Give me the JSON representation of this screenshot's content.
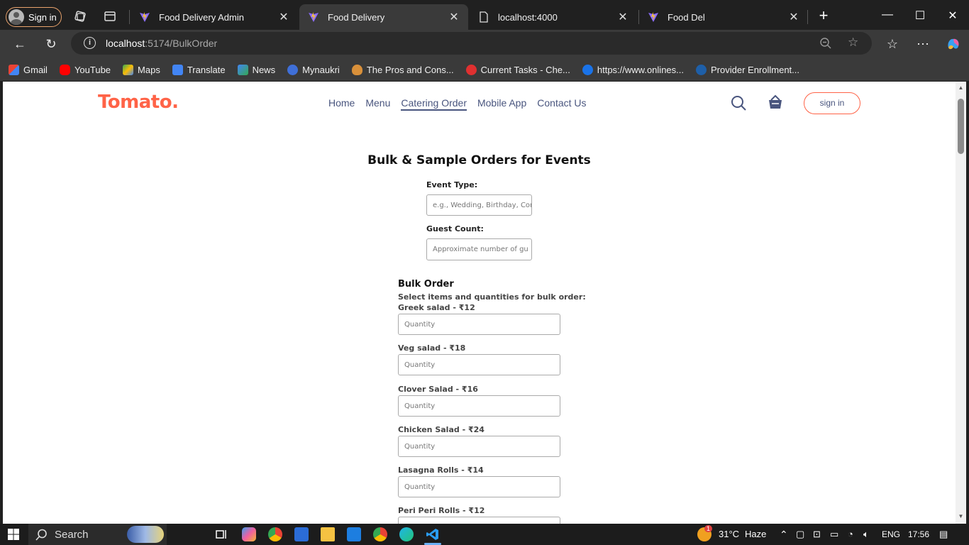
{
  "browser": {
    "profile_label": "Sign in",
    "tabs": [
      {
        "title": "Food Delivery Admin",
        "active": false
      },
      {
        "title": "Food Delivery",
        "active": true
      },
      {
        "title": "localhost:4000",
        "active": false
      },
      {
        "title": "Food Del",
        "active": false
      }
    ],
    "url_host": "localhost",
    "url_path": ":5174/BulkOrder",
    "bookmarks": [
      "Gmail",
      "YouTube",
      "Maps",
      "Translate",
      "News",
      "Mynaukri",
      "The Pros and Cons...",
      "Current Tasks - Che...",
      "https://www.onlines...",
      "Provider Enrollment..."
    ]
  },
  "site": {
    "logo": "Tomato.",
    "menu": [
      "Home",
      "Menu",
      "Catering Order",
      "Mobile App",
      "Contact Us"
    ],
    "active_menu": "Catering Order",
    "signin_label": "sign in"
  },
  "form": {
    "title": "Bulk & Sample Orders for Events",
    "event_type_label": "Event Type:",
    "event_type_placeholder": "e.g., Wedding, Birthday, Corp",
    "guest_count_label": "Guest Count:",
    "guest_count_placeholder": "Approximate number of gu",
    "bulk_heading": "Bulk Order",
    "bulk_sub": "Select items and quantities for bulk order:",
    "quantity_placeholder": "Quantity",
    "items": [
      {
        "label": "Greek salad - ₹12"
      },
      {
        "label": "Veg salad - ₹18"
      },
      {
        "label": "Clover Salad - ₹16"
      },
      {
        "label": "Chicken Salad - ₹24"
      },
      {
        "label": "Lasagna Rolls - ₹14"
      },
      {
        "label": "Peri Peri Rolls - ₹12"
      }
    ]
  },
  "taskbar": {
    "search_label": "Search",
    "weather_temp": "31°C",
    "weather_desc": "Haze",
    "weather_badge": "1",
    "lang": "ENG",
    "time": "17:56"
  }
}
